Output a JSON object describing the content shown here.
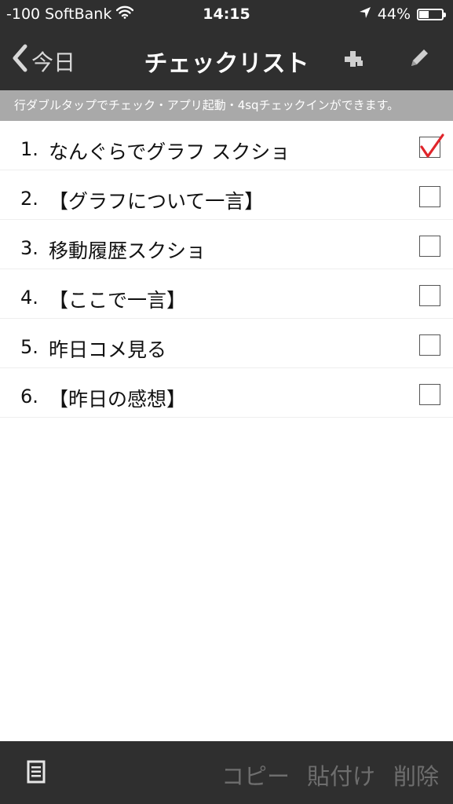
{
  "status_bar": {
    "signal": "-100",
    "carrier": "SoftBank",
    "time": "14:15",
    "battery_text": "44%",
    "battery_level": 0.44
  },
  "nav": {
    "back_label": "今日",
    "title": "チェックリスト"
  },
  "hint": "行ダブルタップでチェック・アプリ起動・4sqチェックインができます。",
  "items": [
    {
      "num": "1.",
      "label": "なんぐらでグラフ スクショ",
      "checked": true
    },
    {
      "num": "2.",
      "label": "【グラフについて一言】",
      "checked": false
    },
    {
      "num": "3.",
      "label": "移動履歴スクショ",
      "checked": false
    },
    {
      "num": "4.",
      "label": "【ここで一言】",
      "checked": false
    },
    {
      "num": "5.",
      "label": "昨日コメ見る",
      "checked": false
    },
    {
      "num": "6.",
      "label": "【昨日の感想】",
      "checked": false
    }
  ],
  "toolbar": {
    "copy": "コピー",
    "paste": "貼付け",
    "delete": "削除"
  },
  "colors": {
    "bar_bg": "#2f2f2f",
    "hint_bg": "#a9a9a9",
    "check_mark": "#e0252b",
    "disabled_text": "#6e6e6e"
  },
  "icons": {
    "wifi": "wifi-icon",
    "location": "location-arrow-icon",
    "battery": "battery-icon",
    "back": "chevron-left-icon",
    "add": "plus-icon",
    "edit": "pencil-icon",
    "document": "document-icon",
    "check": "checkmark-icon"
  }
}
